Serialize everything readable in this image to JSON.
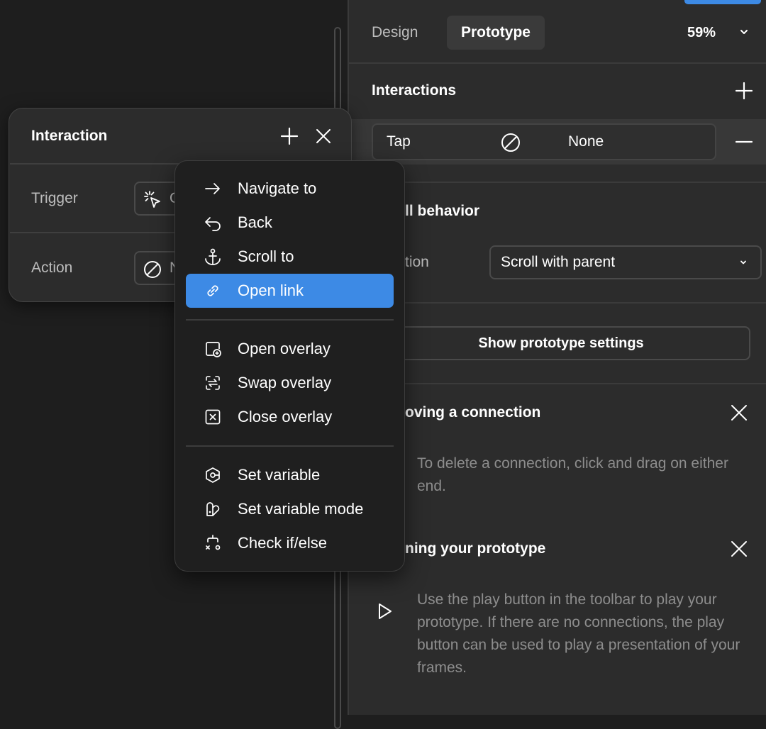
{
  "panel": {
    "tabs": [
      {
        "label": "Design"
      },
      {
        "label": "Prototype"
      }
    ],
    "zoom": "59%",
    "interactions": {
      "title": "Interactions",
      "row": {
        "trigger": "Tap",
        "action": "None"
      }
    },
    "scroll_behavior": {
      "title": "ll behavior",
      "position_label": "tion",
      "value": "Scroll with parent"
    },
    "prototype_settings_button": "Show prototype settings",
    "tips": [
      {
        "title": "oving a connection",
        "body": "To delete a connection, click and drag on either end."
      },
      {
        "title": "ning your prototype",
        "body": "Use the play button in the toolbar to play your prototype. If there are no connections, the play button can be used to play a presentation of your frames."
      }
    ]
  },
  "card": {
    "title": "Interaction",
    "trigger_label": "Trigger",
    "trigger_value": "O",
    "action_label": "Action",
    "action_value": "N"
  },
  "menu": {
    "items": [
      {
        "label": "Navigate to",
        "icon": "arrow-right-icon"
      },
      {
        "label": "Back",
        "icon": "back-arrow-icon"
      },
      {
        "label": "Scroll to",
        "icon": "anchor-icon"
      },
      {
        "label": "Open link",
        "icon": "link-icon",
        "selected": true
      },
      {
        "label": "Open overlay",
        "icon": "open-overlay-icon"
      },
      {
        "label": "Swap overlay",
        "icon": "swap-overlay-icon"
      },
      {
        "label": "Close overlay",
        "icon": "close-overlay-icon"
      },
      {
        "label": "Set variable",
        "icon": "set-variable-icon"
      },
      {
        "label": "Set variable mode",
        "icon": "variable-mode-icon"
      },
      {
        "label": "Check if/else",
        "icon": "conditional-icon"
      }
    ]
  },
  "colors": {
    "accent": "#3d8ae5",
    "panel_bg": "#2c2c2c",
    "canvas_bg": "#1e1e1e",
    "menu_bg": "#1f1f1f"
  }
}
